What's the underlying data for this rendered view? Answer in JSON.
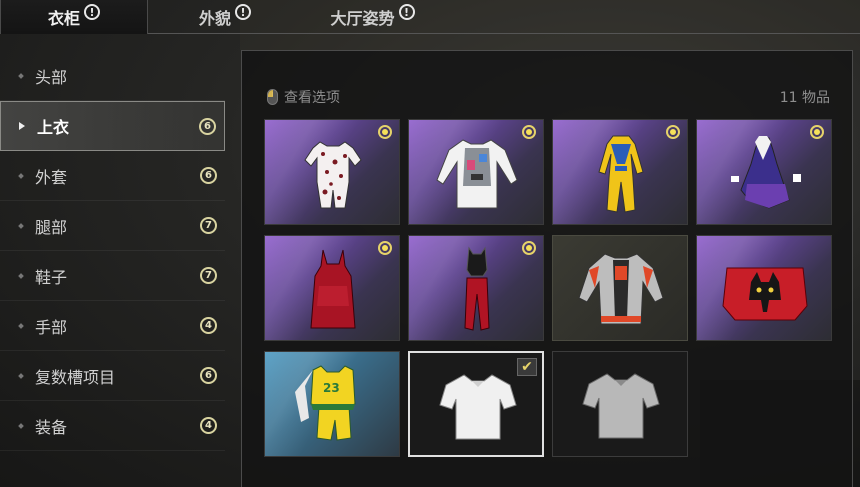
{
  "tabs": [
    {
      "label": "衣柜",
      "alert": "!"
    },
    {
      "label": "外貌",
      "alert": "!"
    },
    {
      "label": "大厅姿势",
      "alert": "!"
    }
  ],
  "sidebar": {
    "items": [
      {
        "label": "头部",
        "count": ""
      },
      {
        "label": "上衣",
        "count": "6"
      },
      {
        "label": "外套",
        "count": "6"
      },
      {
        "label": "腿部",
        "count": "7"
      },
      {
        "label": "鞋子",
        "count": "7"
      },
      {
        "label": "手部",
        "count": "4"
      },
      {
        "label": "复数槽项目",
        "count": "6"
      },
      {
        "label": "装备",
        "count": "4"
      }
    ]
  },
  "panel": {
    "view_options": "查看选项",
    "item_count": "11 物品"
  },
  "items": [
    {
      "icon": "floral-shirt-shorts-icon",
      "rarity": "gold",
      "bg": "purple"
    },
    {
      "icon": "white-jacket-vest-icon",
      "rarity": "gold",
      "bg": "purple"
    },
    {
      "icon": "yellow-blue-suit-icon",
      "rarity": "gold",
      "bg": "purple"
    },
    {
      "icon": "purple-dress-icon",
      "rarity": "gold",
      "bg": "purple"
    },
    {
      "icon": "red-dress-icon",
      "rarity": "gold",
      "bg": "purple"
    },
    {
      "icon": "black-red-outfit-icon",
      "rarity": "gold",
      "bg": "purple"
    },
    {
      "icon": "grey-racing-jacket-icon",
      "rarity": "none",
      "bg": "dark"
    },
    {
      "icon": "red-cat-top-icon",
      "rarity": "none",
      "bg": "purple"
    },
    {
      "icon": "basketball-jersey-icon",
      "rarity": "none",
      "bg": "teal",
      "jersey_number": "23"
    },
    {
      "icon": "white-tshirt-icon",
      "rarity": "none",
      "bg": "plain",
      "equipped": true
    },
    {
      "icon": "grey-tshirt-icon",
      "rarity": "none",
      "bg": "plain"
    }
  ],
  "colors": {
    "accent_gold": "#e6d36a",
    "selected_border": "#e0e0e0"
  }
}
